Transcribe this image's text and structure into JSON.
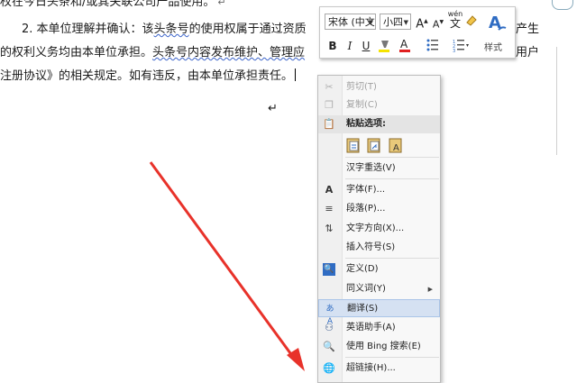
{
  "document": {
    "line0": "权在今日头条和/或其关联公司产品使用。",
    "line1_start": "2.  本单位理解并确认：该",
    "line1_link": "头条号",
    "line1_end": "的使用权属于通过资质",
    "line1_right": "产生",
    "line2_start": "的权利义务均由本单位承担。",
    "line2_link": "头条号内容发布维护、管理应",
    "line2_right": "用户",
    "line3": "注册协议》的相关规定。如有违反，由本单位承担责任。",
    "para_mark": "↵"
  },
  "mini_toolbar": {
    "font_name": "宋体 (中文",
    "font_size": "小四",
    "grow_font": "A",
    "shrink_font": "A",
    "phonetic": "wén",
    "style_label": "样式",
    "bold": "B",
    "italic": "I",
    "underline": "U",
    "highlight_color": "#f5e300",
    "font_color": "#e02020",
    "accent": "#2f6cc3"
  },
  "context_menu": {
    "cut": "剪切(T)",
    "copy": "复制(C)",
    "paste_options": "粘贴选项:",
    "reselect": "汉字重选(V)",
    "font": "字体(F)...",
    "paragraph": "段落(P)...",
    "text_direction": "文字方向(X)...",
    "insert_symbol": "插入符号(S)",
    "define": "定义(D)",
    "synonyms": "同义词(Y)",
    "translate": "翻译(S)",
    "english_assistant": "英语助手(A)",
    "bing_search": "使用 Bing 搜索(E)",
    "hyperlink": "超链接(H)..."
  },
  "arrow_color": "#e8322a"
}
